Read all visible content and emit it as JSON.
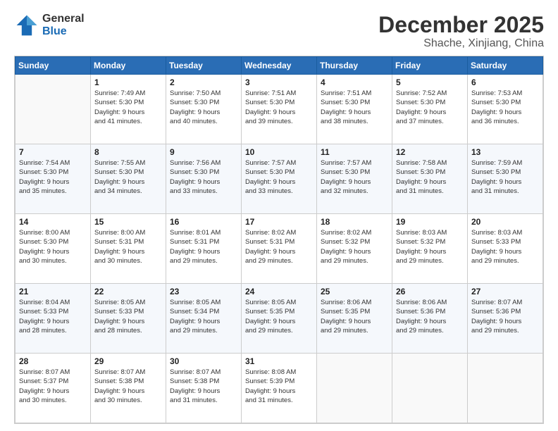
{
  "logo": {
    "general": "General",
    "blue": "Blue"
  },
  "header": {
    "month": "December 2025",
    "location": "Shache, Xinjiang, China"
  },
  "weekdays": [
    "Sunday",
    "Monday",
    "Tuesday",
    "Wednesday",
    "Thursday",
    "Friday",
    "Saturday"
  ],
  "weeks": [
    [
      {
        "day": "",
        "info": ""
      },
      {
        "day": "1",
        "info": "Sunrise: 7:49 AM\nSunset: 5:30 PM\nDaylight: 9 hours\nand 41 minutes."
      },
      {
        "day": "2",
        "info": "Sunrise: 7:50 AM\nSunset: 5:30 PM\nDaylight: 9 hours\nand 40 minutes."
      },
      {
        "day": "3",
        "info": "Sunrise: 7:51 AM\nSunset: 5:30 PM\nDaylight: 9 hours\nand 39 minutes."
      },
      {
        "day": "4",
        "info": "Sunrise: 7:51 AM\nSunset: 5:30 PM\nDaylight: 9 hours\nand 38 minutes."
      },
      {
        "day": "5",
        "info": "Sunrise: 7:52 AM\nSunset: 5:30 PM\nDaylight: 9 hours\nand 37 minutes."
      },
      {
        "day": "6",
        "info": "Sunrise: 7:53 AM\nSunset: 5:30 PM\nDaylight: 9 hours\nand 36 minutes."
      }
    ],
    [
      {
        "day": "7",
        "info": "Sunrise: 7:54 AM\nSunset: 5:30 PM\nDaylight: 9 hours\nand 35 minutes."
      },
      {
        "day": "8",
        "info": "Sunrise: 7:55 AM\nSunset: 5:30 PM\nDaylight: 9 hours\nand 34 minutes."
      },
      {
        "day": "9",
        "info": "Sunrise: 7:56 AM\nSunset: 5:30 PM\nDaylight: 9 hours\nand 33 minutes."
      },
      {
        "day": "10",
        "info": "Sunrise: 7:57 AM\nSunset: 5:30 PM\nDaylight: 9 hours\nand 33 minutes."
      },
      {
        "day": "11",
        "info": "Sunrise: 7:57 AM\nSunset: 5:30 PM\nDaylight: 9 hours\nand 32 minutes."
      },
      {
        "day": "12",
        "info": "Sunrise: 7:58 AM\nSunset: 5:30 PM\nDaylight: 9 hours\nand 31 minutes."
      },
      {
        "day": "13",
        "info": "Sunrise: 7:59 AM\nSunset: 5:30 PM\nDaylight: 9 hours\nand 31 minutes."
      }
    ],
    [
      {
        "day": "14",
        "info": "Sunrise: 8:00 AM\nSunset: 5:30 PM\nDaylight: 9 hours\nand 30 minutes."
      },
      {
        "day": "15",
        "info": "Sunrise: 8:00 AM\nSunset: 5:31 PM\nDaylight: 9 hours\nand 30 minutes."
      },
      {
        "day": "16",
        "info": "Sunrise: 8:01 AM\nSunset: 5:31 PM\nDaylight: 9 hours\nand 29 minutes."
      },
      {
        "day": "17",
        "info": "Sunrise: 8:02 AM\nSunset: 5:31 PM\nDaylight: 9 hours\nand 29 minutes."
      },
      {
        "day": "18",
        "info": "Sunrise: 8:02 AM\nSunset: 5:32 PM\nDaylight: 9 hours\nand 29 minutes."
      },
      {
        "day": "19",
        "info": "Sunrise: 8:03 AM\nSunset: 5:32 PM\nDaylight: 9 hours\nand 29 minutes."
      },
      {
        "day": "20",
        "info": "Sunrise: 8:03 AM\nSunset: 5:33 PM\nDaylight: 9 hours\nand 29 minutes."
      }
    ],
    [
      {
        "day": "21",
        "info": "Sunrise: 8:04 AM\nSunset: 5:33 PM\nDaylight: 9 hours\nand 28 minutes."
      },
      {
        "day": "22",
        "info": "Sunrise: 8:05 AM\nSunset: 5:33 PM\nDaylight: 9 hours\nand 28 minutes."
      },
      {
        "day": "23",
        "info": "Sunrise: 8:05 AM\nSunset: 5:34 PM\nDaylight: 9 hours\nand 29 minutes."
      },
      {
        "day": "24",
        "info": "Sunrise: 8:05 AM\nSunset: 5:35 PM\nDaylight: 9 hours\nand 29 minutes."
      },
      {
        "day": "25",
        "info": "Sunrise: 8:06 AM\nSunset: 5:35 PM\nDaylight: 9 hours\nand 29 minutes."
      },
      {
        "day": "26",
        "info": "Sunrise: 8:06 AM\nSunset: 5:36 PM\nDaylight: 9 hours\nand 29 minutes."
      },
      {
        "day": "27",
        "info": "Sunrise: 8:07 AM\nSunset: 5:36 PM\nDaylight: 9 hours\nand 29 minutes."
      }
    ],
    [
      {
        "day": "28",
        "info": "Sunrise: 8:07 AM\nSunset: 5:37 PM\nDaylight: 9 hours\nand 30 minutes."
      },
      {
        "day": "29",
        "info": "Sunrise: 8:07 AM\nSunset: 5:38 PM\nDaylight: 9 hours\nand 30 minutes."
      },
      {
        "day": "30",
        "info": "Sunrise: 8:07 AM\nSunset: 5:38 PM\nDaylight: 9 hours\nand 31 minutes."
      },
      {
        "day": "31",
        "info": "Sunrise: 8:08 AM\nSunset: 5:39 PM\nDaylight: 9 hours\nand 31 minutes."
      },
      {
        "day": "",
        "info": ""
      },
      {
        "day": "",
        "info": ""
      },
      {
        "day": "",
        "info": ""
      }
    ]
  ]
}
